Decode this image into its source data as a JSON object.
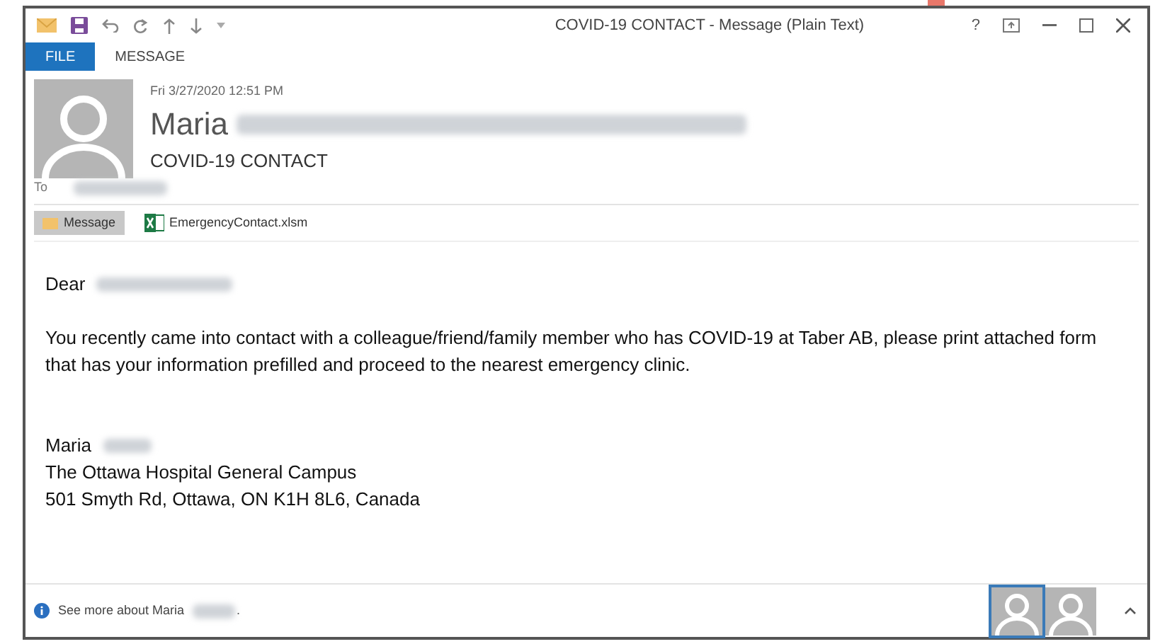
{
  "window": {
    "title": "COVID-19 CONTACT - Message (Plain Text)",
    "help": "?"
  },
  "ribbon_tabs": [
    {
      "label": "FILE",
      "selected": true
    },
    {
      "label": "MESSAGE",
      "selected": false
    }
  ],
  "header": {
    "date": "Fri 3/27/2020 12:51 PM",
    "sender": "Maria",
    "subject": "COVID-19 CONTACT",
    "to_label": "To"
  },
  "attachments": [
    {
      "kind": "message",
      "label": "Message",
      "selected": true
    },
    {
      "kind": "excel",
      "label": "EmergencyContact.xlsm",
      "selected": false
    }
  ],
  "body": {
    "greeting": "Dear",
    "paragraph": "You recently came into contact with a colleague/friend/family member who has COVID-19 at  Taber AB, please print attached form that has your information prefilled and proceed to the nearest emergency clinic.",
    "signature": [
      "Maria",
      "The Ottawa Hospital General Campus",
      "501 Smyth Rd, Ottawa, ON K1H 8L6, Canada"
    ]
  },
  "people_pane": {
    "text": "See more about Maria",
    "end": ".",
    "avatars": [
      {
        "selected": true
      },
      {
        "selected": false
      }
    ]
  }
}
